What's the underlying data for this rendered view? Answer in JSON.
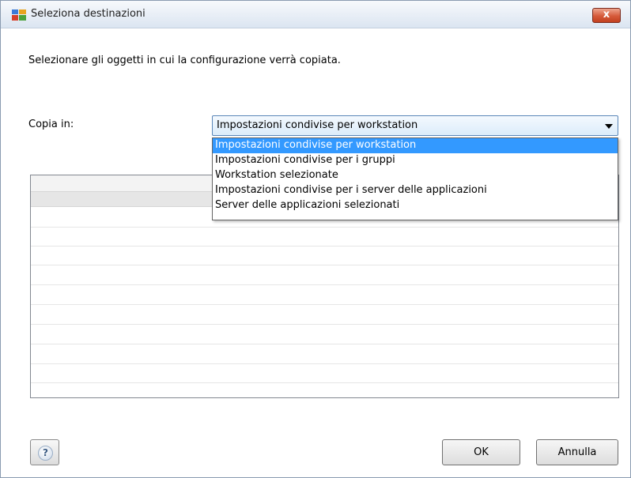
{
  "window": {
    "title": "Seleziona destinazioni",
    "close_label": "x"
  },
  "content": {
    "instructions": "Selezionare gli oggetti in cui la configurazione verrà copiata.",
    "copy_label": "Copia in:"
  },
  "select": {
    "value": "Impostazioni condivise per workstation",
    "options": [
      "Impostazioni condivise per workstation",
      "Impostazioni condivise per i gruppi",
      "Workstation selezionate",
      "Impostazioni condivise per i server delle applicazioni",
      "Server delle applicazioni selezionati"
    ],
    "highlighted_index": 0
  },
  "buttons": {
    "help_icon": "?",
    "ok": "OK",
    "cancel": "Annulla"
  },
  "icons": {
    "app": "avg-logo-icon",
    "close": "close-icon",
    "help": "help-icon",
    "dropdown": "chevron-down-icon"
  },
  "colors": {
    "highlight": "#3399ff",
    "close_button": "#d55a3a",
    "select_border": "#5a86b8"
  }
}
